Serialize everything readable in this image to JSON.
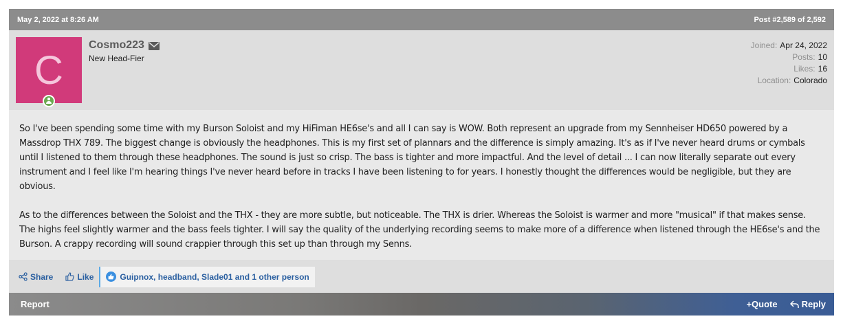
{
  "header": {
    "date": "May 2, 2022 at 8:26 AM",
    "post_number": "Post #2,589 of 2,592"
  },
  "user": {
    "avatar_letter": "C",
    "avatar_color": "#d13a7a",
    "username": "Cosmo223",
    "title": "New Head-Fier",
    "stats": [
      {
        "label": "Joined:",
        "value": "Apr 24, 2022"
      },
      {
        "label": "Posts:",
        "value": "10"
      },
      {
        "label": "Likes:",
        "value": "16"
      },
      {
        "label": "Location:",
        "value": "Colorado"
      }
    ]
  },
  "content": {
    "paragraphs": [
      "So I've been spending some time with my Burson Soloist and my HiFiman HE6se's and all I can say is WOW. Both represent an upgrade from my Sennheiser HD650 powered by a Massdrop THX 789. The biggest change is obviously the headphones. This is my first set of plannars and the difference is simply amazing. It's as if I've never heard drums or cymbals until I listened to them through these headphones. The sound is just so crisp. The bass is tighter and more impactful. And the level of detail ... I can now literally separate out every instrument and I feel like I'm hearing things I've never heard before in tracks I have been listening to for years. I honestly thought the differences would be negligible, but they are obvious.",
      "As to the differences between the Soloist and the THX - they are more subtle, but noticeable. The THX is drier. Whereas the Soloist is warmer and more \"musical\" if that makes sense. The highs feel slightly warmer and the bass feels tighter. I will say the quality of the underlying recording seems to make more of a difference when listened through the HE6se's and the Burson. A crappy recording will sound crappier through this set up than through my Senns."
    ]
  },
  "actions": {
    "share_label": "Share",
    "like_label": "Like",
    "reactions_text": "Guipnox, headband, Slade01 and 1 other person"
  },
  "footer": {
    "report_label": "Report",
    "quote_label": "+Quote",
    "reply_label": "Reply"
  }
}
